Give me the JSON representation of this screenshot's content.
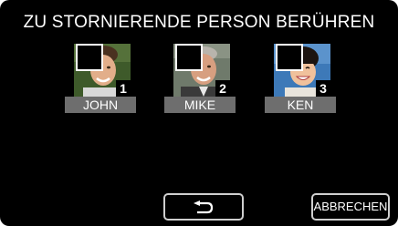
{
  "title": "ZU STORNIERENDE PERSON BERÜHREN",
  "people": [
    {
      "number": "1",
      "name": "JOHN",
      "checked": false
    },
    {
      "number": "2",
      "name": "MIKE",
      "checked": false
    },
    {
      "number": "3",
      "name": "KEN",
      "checked": false
    }
  ],
  "buttons": {
    "back_icon": "return-arrow-icon",
    "cancel_label": "ABBRECHEN"
  },
  "colors": {
    "background": "#000000",
    "name_bar": "#6e6e6e",
    "button_border": "#cfcfcf"
  }
}
